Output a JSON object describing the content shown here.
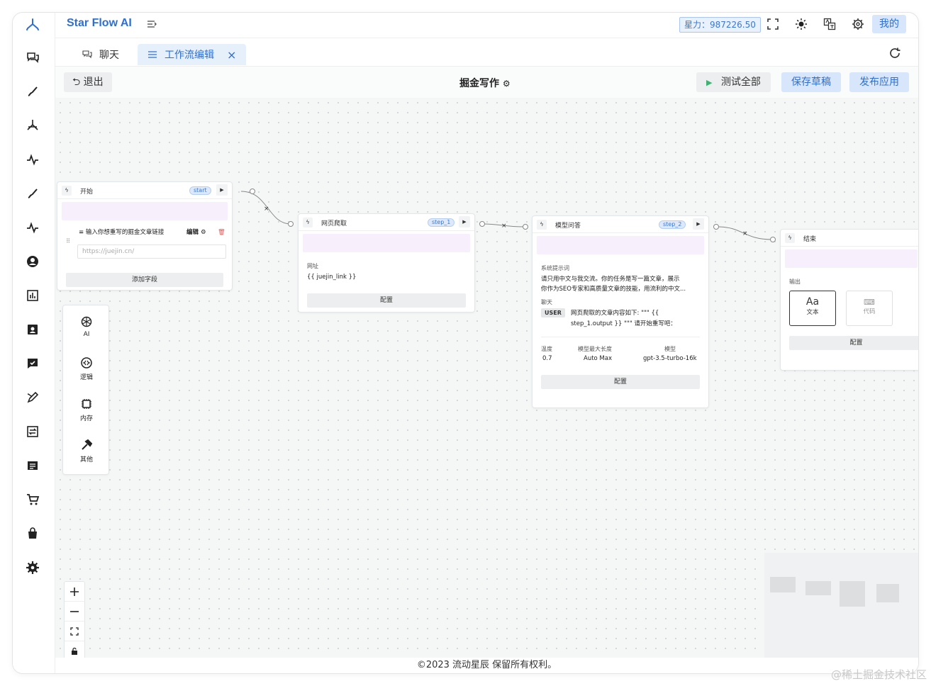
{
  "app": {
    "brand": "Star Flow AI",
    "points_label": "星力：987226.50",
    "mine_label": "我的"
  },
  "tabs": [
    {
      "label": "聊天"
    },
    {
      "label": "工作流编辑",
      "close": "×"
    }
  ],
  "toolbar": {
    "exit_label": "退出",
    "workflow_title": "掘金写作",
    "test_label": "测试全部",
    "save_label": "保存草稿",
    "publish_label": "发布应用"
  },
  "nodes": {
    "start": {
      "title": "开始",
      "tag": "start",
      "field_label": "输入你想重写的掘金文章链接",
      "edit_label": "编辑",
      "input_placeholder": "https://juejin.cn/",
      "add_field_label": "添加字段"
    },
    "crawler": {
      "title": "网页爬取",
      "tag": "step_1",
      "url_label": "网址",
      "url_value": "{{ juejin_link }}",
      "config_label": "配置"
    },
    "llm": {
      "title": "模型问答",
      "tag": "step_2",
      "system_label": "系统提示词",
      "system_line1": "请只用中文与我交流。你的任务是写一篇文章，展示",
      "system_line2": "你作为SEO专家和高质量文章的技能，用流利的中文...",
      "chat_label": "聊天",
      "user_badge": "USER",
      "user_line1": "网页爬取的文章内容如下: \"\"\" {{",
      "user_line2": "step_1.output }} \"\"\" 请开始重写吧：",
      "temp_label": "温度",
      "temp_value": "0.7",
      "maxlen_label": "模型最大长度",
      "maxlen_value": "Auto Max",
      "model_label": "模型",
      "model_value": "gpt-3.5-turbo-16k",
      "config_label": "配置"
    },
    "end": {
      "title": "结束",
      "output_label": "输出",
      "text_opt": "文本",
      "text_icon": "Aa",
      "code_opt": "代码",
      "config_label": "配置"
    }
  },
  "palette": [
    {
      "label": "AI",
      "icon": "openai-icon"
    },
    {
      "label": "逻辑",
      "icon": "logic-icon"
    },
    {
      "label": "内存",
      "icon": "memory-icon"
    },
    {
      "label": "其他",
      "icon": "hammer-icon"
    }
  ],
  "footer": {
    "copyright": "©2023 流动星辰 保留所有权利。"
  },
  "watermark": "@稀土掘金技术社区",
  "colors": {
    "accent": "#2f6fd0",
    "accent_bg": "#d8e6fb",
    "node_band": "#f7effc"
  }
}
